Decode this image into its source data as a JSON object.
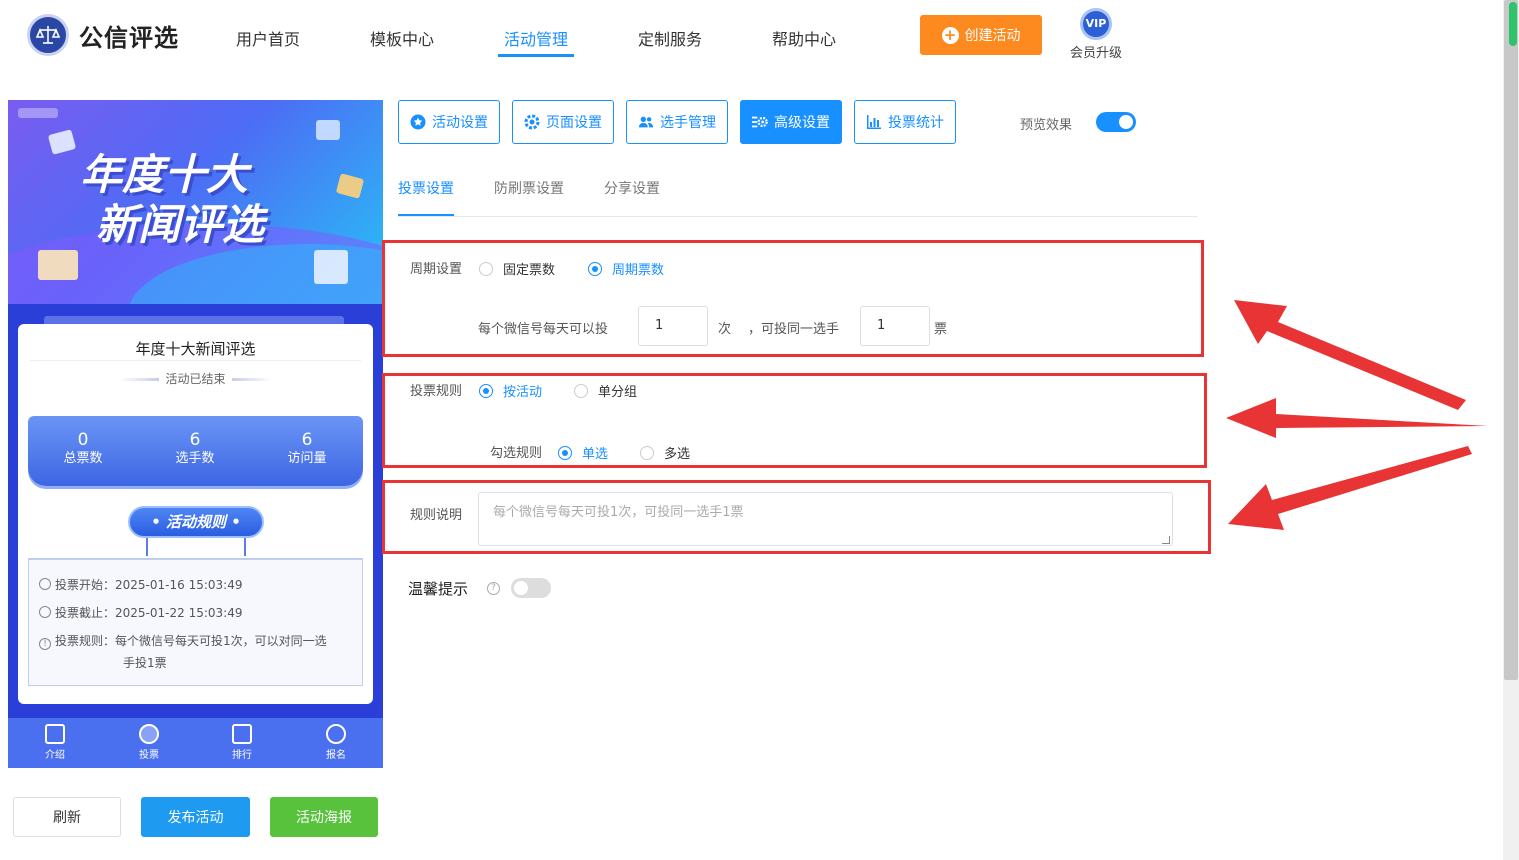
{
  "header": {
    "brand": "公信评选",
    "nav": [
      "用户首页",
      "模板中心",
      "活动管理",
      "定制服务",
      "帮助中心"
    ],
    "active_nav": "活动管理",
    "create_button": "创建活动",
    "vip_badge": "VIP",
    "vip_label": "会员升级"
  },
  "preview": {
    "banner_line1": "年度十大",
    "banner_line2": "新闻评选",
    "card_title": "年度十大新闻评选",
    "status": "活动已结束",
    "stats": [
      {
        "value": "0",
        "label": "总票数"
      },
      {
        "value": "6",
        "label": "选手数"
      },
      {
        "value": "6",
        "label": "访问量"
      }
    ],
    "rules_button": "• 活动规则 •",
    "info": [
      {
        "key": "投票开始：",
        "value": "2025-01-16 15:03:49"
      },
      {
        "key": "投票截止：",
        "value": "2025-01-22 15:03:49"
      },
      {
        "key": "投票规则：",
        "value": "每个微信号每天可投1次，可以对同一选",
        "value2": "手投1票"
      }
    ],
    "tabs": [
      "介绍",
      "投票",
      "排行",
      "报名"
    ]
  },
  "actions": {
    "refresh": "刷新",
    "publish": "发布活动",
    "poster": "活动海报"
  },
  "toolbar": {
    "buttons": [
      "活动设置",
      "页面设置",
      "选手管理",
      "高级设置",
      "投票统计"
    ],
    "active": "高级设置",
    "preview_label": "预览效果",
    "preview_on": true
  },
  "subtabs": [
    "投票设置",
    "防刷票设置",
    "分享设置"
  ],
  "period": {
    "label": "周期设置",
    "options": [
      "固定票数",
      "周期票数"
    ],
    "selected": "周期票数",
    "per_day_prefix": "每个微信号每天可以投",
    "per_day_value": "1",
    "times_unit": "次",
    "same_player_prefix": "，可投同一选手",
    "same_player_value": "1",
    "votes_unit": "票"
  },
  "vote_rule": {
    "label": "投票规则",
    "options": [
      "按活动",
      "单分组"
    ],
    "selected": "按活动",
    "check_label": "勾选规则",
    "check_options": [
      "单选",
      "多选"
    ],
    "check_selected": "单选"
  },
  "rule_desc": {
    "label": "规则说明",
    "placeholder": "每个微信号每天可投1次，可投同一选手1票"
  },
  "tip": {
    "label": "温馨提示",
    "enabled": false
  },
  "colors": {
    "primary": "#1890ff",
    "orange": "#fd8a1e",
    "green": "#58c23c",
    "annotation": "#e83434"
  }
}
